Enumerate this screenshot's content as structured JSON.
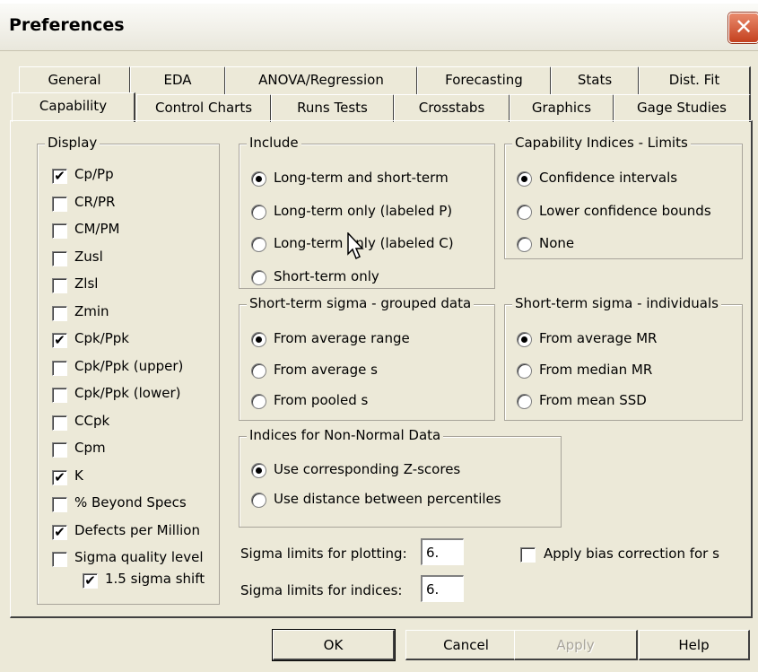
{
  "window": {
    "title": "Preferences",
    "close_glyph": "✕"
  },
  "tabs_row1": [
    "General",
    "EDA",
    "ANOVA/Regression",
    "Forecasting",
    "Stats",
    "Dist. Fit"
  ],
  "tabs_row2": [
    "Capability",
    "Control Charts",
    "Runs Tests",
    "Crosstabs",
    "Graphics",
    "Gage Studies"
  ],
  "active_tab": "Capability",
  "display": {
    "label": "Display",
    "items": [
      {
        "label": "Cp/Pp",
        "checked": true
      },
      {
        "label": "CR/PR",
        "checked": false
      },
      {
        "label": "CM/PM",
        "checked": false
      },
      {
        "label": "Zusl",
        "checked": false
      },
      {
        "label": "Zlsl",
        "checked": false
      },
      {
        "label": "Zmin",
        "checked": false
      },
      {
        "label": "Cpk/Ppk",
        "checked": true
      },
      {
        "label": "Cpk/Ppk (upper)",
        "checked": false
      },
      {
        "label": "Cpk/Ppk (lower)",
        "checked": false
      },
      {
        "label": "CCpk",
        "checked": false
      },
      {
        "label": "Cpm",
        "checked": false
      },
      {
        "label": "K",
        "checked": true
      },
      {
        "label": "% Beyond Specs",
        "checked": false
      },
      {
        "label": "Defects per Million",
        "checked": true
      },
      {
        "label": "Sigma quality level",
        "checked": false
      },
      {
        "label": "1.5 sigma shift",
        "checked": true
      }
    ]
  },
  "include": {
    "label": "Include",
    "options": [
      "Long-term and short-term",
      "Long-term only (labeled P)",
      "Long-term only (labeled C)",
      "Short-term only"
    ],
    "selected": 0
  },
  "cap_limits": {
    "label": "Capability Indices - Limits",
    "options": [
      "Confidence intervals",
      "Lower confidence bounds",
      "None"
    ],
    "selected": 0
  },
  "grouped": {
    "label": "Short-term sigma - grouped data",
    "options": [
      "From average range",
      "From average s",
      "From pooled s"
    ],
    "selected": 0
  },
  "individuals": {
    "label": "Short-term sigma - individuals",
    "options": [
      "From average MR",
      "From median MR",
      "From mean SSD"
    ],
    "selected": 0
  },
  "nonnormal": {
    "label": "Indices for Non-Normal Data",
    "options": [
      "Use corresponding Z-scores",
      "Use distance between percentiles"
    ],
    "selected": 0
  },
  "sigma_plot": {
    "label": "Sigma limits for plotting:",
    "value": "6."
  },
  "sigma_indices": {
    "label": "Sigma limits for indices:",
    "value": "6."
  },
  "bias": {
    "label": "Apply bias correction for s",
    "checked": false
  },
  "buttons": {
    "ok": "OK",
    "cancel": "Cancel",
    "apply": "Apply",
    "help": "Help"
  },
  "check_glyph": "✔"
}
